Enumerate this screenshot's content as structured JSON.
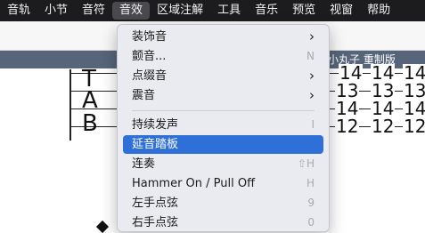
{
  "menubar": {
    "items": [
      "音轨",
      "小节",
      "音符",
      "音效",
      "区域注解",
      "工具",
      "音乐",
      "预览",
      "视窗",
      "帮助"
    ]
  },
  "document": {
    "title": "小丸子 重制版"
  },
  "tab": {
    "letters": [
      "T",
      "A",
      "B"
    ],
    "numbers": [
      [
        "14",
        "14",
        "14"
      ],
      [
        "13",
        "13",
        "13"
      ],
      [
        "14",
        "14",
        "14"
      ],
      [
        "12",
        "12",
        "12"
      ]
    ]
  },
  "menu": {
    "items": [
      {
        "label": "装饰音",
        "shortcut": "",
        "submenu": true
      },
      {
        "label": "颤音...",
        "shortcut": "N",
        "submenu": false
      },
      {
        "label": "点缀音",
        "shortcut": "",
        "submenu": true
      },
      {
        "label": "震音",
        "shortcut": "",
        "submenu": true
      },
      {
        "label": "持续发声",
        "shortcut": "I",
        "submenu": false
      },
      {
        "label": "延音踏板",
        "shortcut": "",
        "submenu": false
      },
      {
        "label": "连奏",
        "shortcut": "⇧H",
        "submenu": false
      },
      {
        "label": "Hammer On / Pull Off",
        "shortcut": "H",
        "submenu": false
      },
      {
        "label": "左手点弦",
        "shortcut": "9",
        "submenu": false
      },
      {
        "label": "右手点弦",
        "shortcut": "0",
        "submenu": false
      }
    ],
    "chevron": "›"
  },
  "colors": {
    "menubar_bg": "#1c1c1e",
    "highlight": "#2f6fd8",
    "title_bar": "#56657a"
  }
}
